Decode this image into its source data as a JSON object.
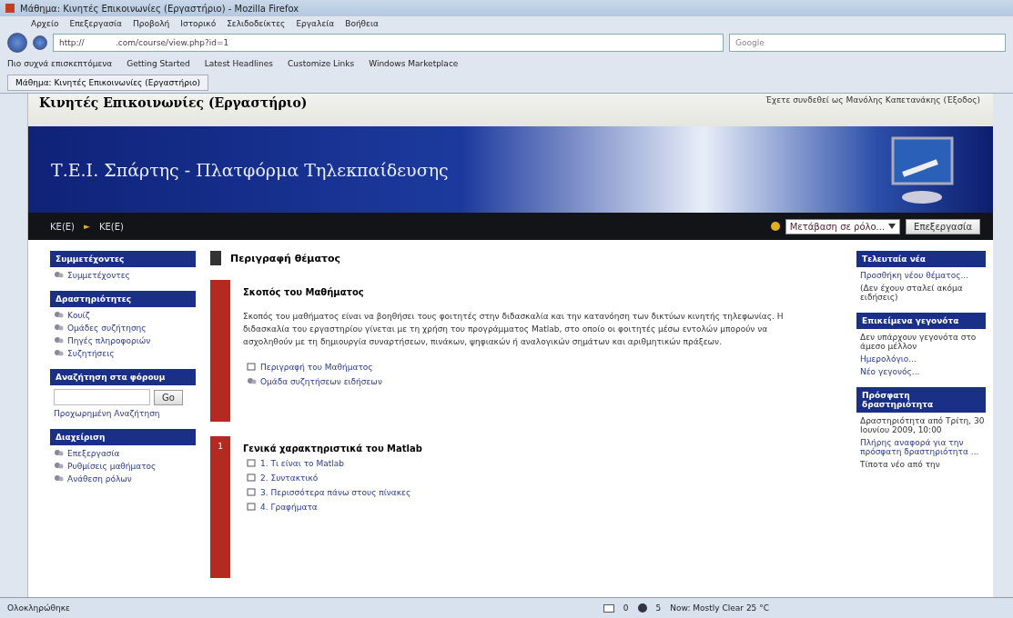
{
  "window": {
    "title": "Μάθημα: Κινητές Επικοινωνίες (Εργαστήριο) - Mozilla Firefox"
  },
  "menu": [
    "Αρχείο",
    "Επεξεργασία",
    "Προβολή",
    "Ιστορικό",
    "Σελιδοδείκτες",
    "Εργαλεία",
    "Βοήθεια"
  ],
  "address_bar": {
    "value": "http://            .com/course/view.php?id=1"
  },
  "search": {
    "placeholder": "Google"
  },
  "bookmarks": [
    "Πιο συχνά επισκεπτόμενα",
    "Getting Started",
    "Latest Headlines",
    "Customize Links",
    "Windows Marketplace"
  ],
  "tab": {
    "label": "Μάθημα: Κινητές Επικοινωνίες (Εργαστήριο)"
  },
  "page": {
    "course_title": "Κινητές Επικοινωνίες (Εργαστήριο)",
    "login_info": "Έχετε συνδεθεί ως Μανόλης Καπετανάκης (Έξοδος)",
    "banner_title": "Τ.Ε.Ι. Σπάρτης - Πλατφόρμα Τηλεκπαίδευσης",
    "breadcrumb": [
      "ΚΕ(Ε)",
      "ΚΕ(Ε)"
    ],
    "breadcrumb_separator": "►",
    "role_select": {
      "value": "Μετάβαση σε ρόλο..."
    },
    "edit_button": "Επεξεργασία"
  },
  "left_blocks": [
    {
      "kind": "list",
      "title": "Συμμετέχοντες",
      "items": [
        "Συμμετέχοντες"
      ]
    },
    {
      "kind": "list",
      "title": "Δραστηριότητες",
      "items": [
        "Κουίζ",
        "Ομάδες συζήτησης",
        "Πηγές πληροφοριών",
        "Συζητήσεις"
      ]
    },
    {
      "kind": "search",
      "title": "Αναζήτηση στα φόρουμ",
      "button": "Go",
      "link": "Προχωρημένη Αναζήτηση"
    },
    {
      "kind": "list",
      "title": "Διαχείριση",
      "items": [
        "Επεξεργασία",
        "Ρυθμίσεις μαθήματος",
        "Ανάθεση ρόλων"
      ]
    }
  ],
  "center": {
    "heading": "Περιγραφή θέματος",
    "sections": [
      {
        "title": "Σκοπός του Μαθήματος",
        "text": "Σκοπός του μαθήματος είναι να βοηθήσει τους φοιτητές στην διδασκαλία και την κατανόηση των δικτύων κινητής τηλεφωνίας. Η διδασκαλία του εργαστηρίου γίνεται με τη χρήση του προγράμματος Matlab, στο οποίο οι φοιτητές μέσω εντολών μπορούν να ασχοληθούν με τη δημιουργία συναρτήσεων, πινάκων, ψηφιακών ή αναλογικών σημάτων και αριθμητικών πράξεων.",
        "links": [
          {
            "kind": "page",
            "label": "Περιγραφή του Μαθήματος"
          },
          {
            "kind": "forum",
            "label": "Ομάδα συζητήσεων ειδήσεων"
          }
        ]
      },
      {
        "number": "1",
        "title": "Γενικά χαρακτηριστικά του Matlab",
        "links": [
          {
            "kind": "page",
            "label": "1. Τι είναι το Matlab"
          },
          {
            "kind": "page",
            "label": "2. Συντακτικό"
          },
          {
            "kind": "page",
            "label": "3. Περισσότερα πάνω στους πίνακες"
          },
          {
            "kind": "page",
            "label": "4. Γραφήματα"
          }
        ]
      }
    ]
  },
  "right_blocks": [
    {
      "title": "Τελευταία νέα",
      "lines": [
        {
          "kind": "link",
          "text": "Προσθήκη νέου θέματος..."
        },
        {
          "kind": "note",
          "text": "(Δεν έχουν σταλεί ακόμα ειδήσεις)"
        }
      ]
    },
    {
      "title": "Επικείμενα γεγονότα",
      "lines": [
        {
          "kind": "note",
          "text": "Δεν υπάρχουν γεγονότα στο άμεσο μέλλον"
        },
        {
          "kind": "link",
          "text": "Ημερολόγιο..."
        },
        {
          "kind": "link",
          "text": "Νέο γεγονός..."
        }
      ]
    },
    {
      "title": "Πρόσφατη δραστηριότητα",
      "lines": [
        {
          "kind": "note",
          "text": "Δραστηριότητα από Τρίτη, 30 Ιουνίου 2009, 10:00"
        },
        {
          "kind": "link",
          "text": "Πλήρης αναφορά για την πρόσφατη δραστηριότητα ..."
        },
        {
          "kind": "note",
          "text": "Τίποτα νέο από την"
        }
      ]
    }
  ],
  "status_bar": {
    "text": "Ολοκληρώθηκε",
    "mail_count": "0",
    "count": "5",
    "weather": "Now: Mostly Clear  25 °C"
  }
}
